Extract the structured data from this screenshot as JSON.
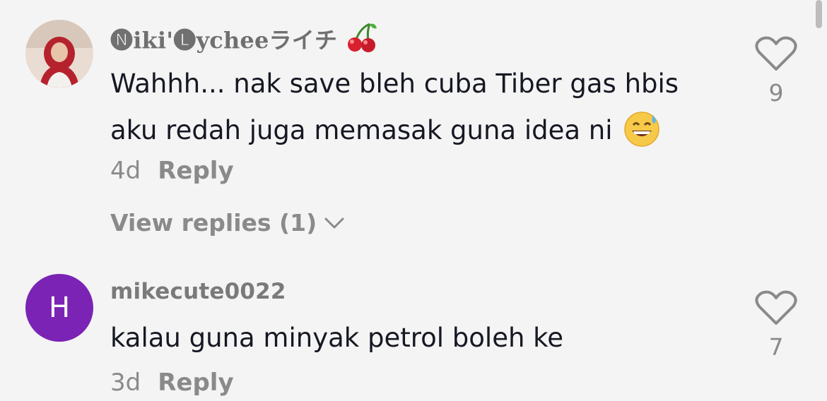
{
  "comments": [
    {
      "username": "🅝iki'🅛ycheeライチ",
      "username_emoji": "cherries-icon",
      "text": "Wahhh... nak save bleh cuba Tiber gas hbis aku redah juga memasak guna idea ni",
      "text_emoji": "grinning-sweat-emoji",
      "age": "4d",
      "reply_label": "Reply",
      "likes": "9",
      "view_replies": "View replies (1)",
      "avatar": "photo"
    },
    {
      "username": "mikecute0022",
      "avatar_letter": "H",
      "avatar_color": "#7b23b5",
      "text": "kalau guna minyak petrol boleh ke",
      "age": "3d",
      "reply_label": "Reply",
      "likes": "7"
    }
  ],
  "colors": {
    "background": "#f4f4f4",
    "text": "#161823",
    "muted": "#8a8a8a"
  }
}
